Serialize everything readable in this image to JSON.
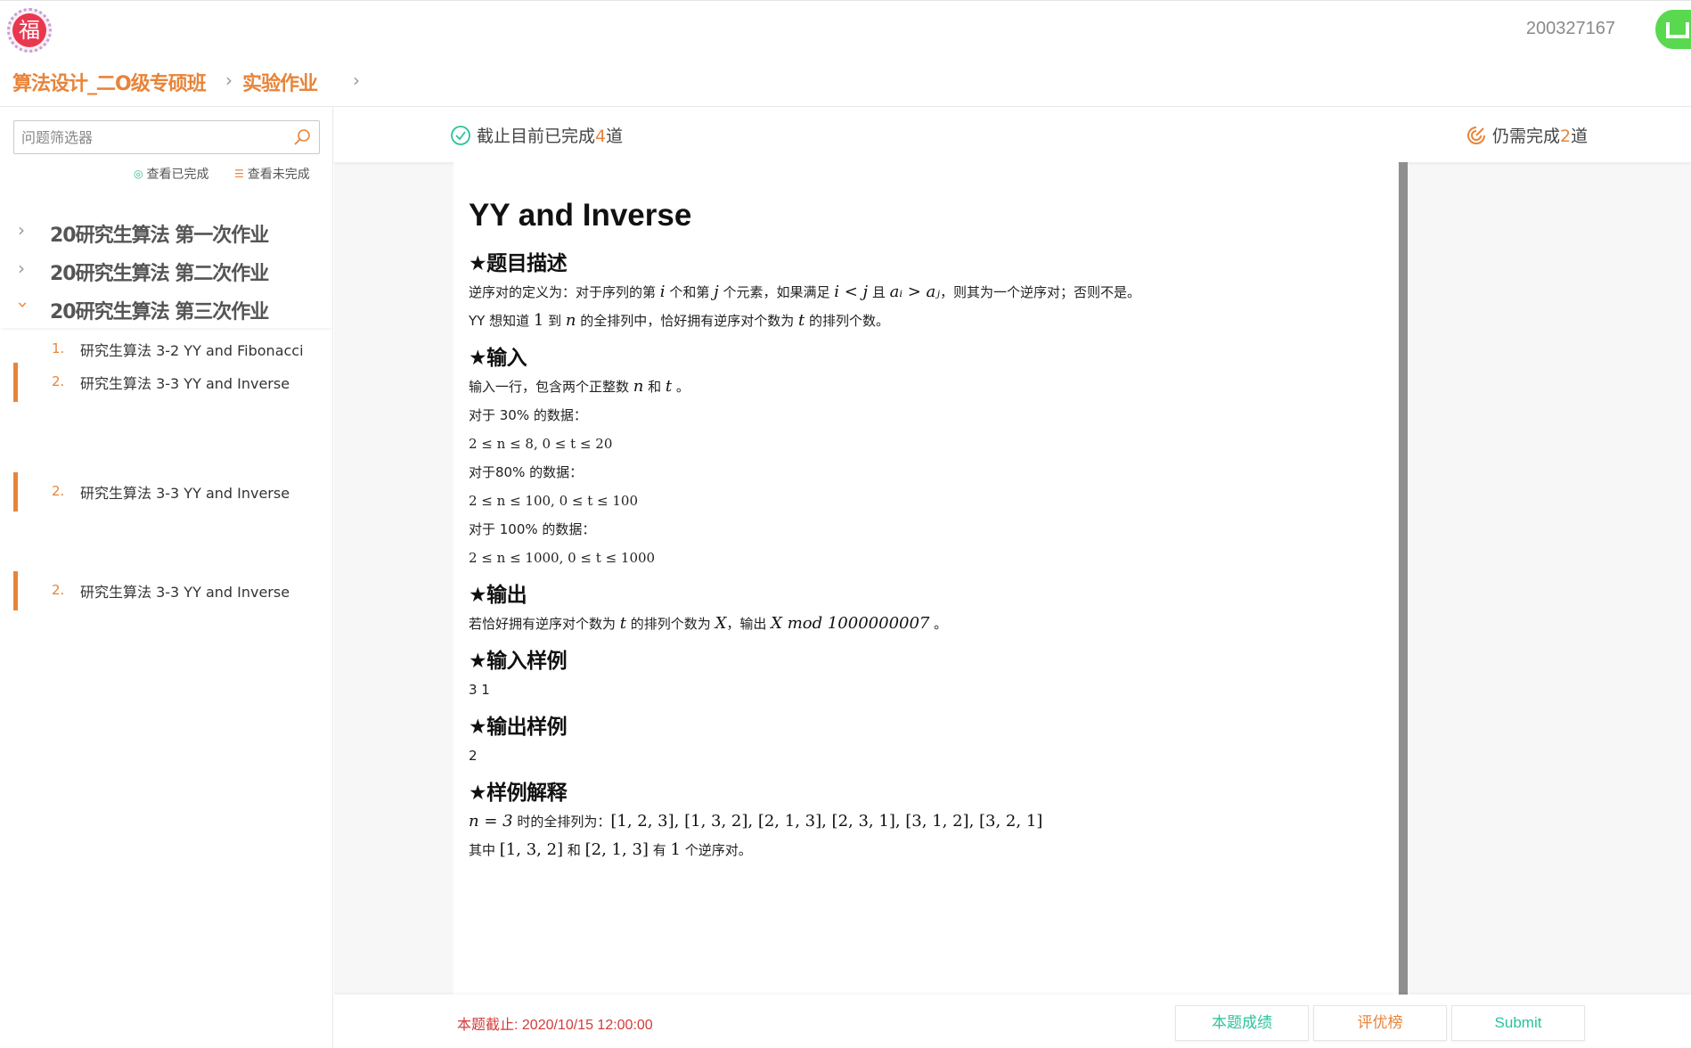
{
  "header": {
    "logo_char": "福",
    "user_id": "200327167"
  },
  "breadcrumb": {
    "course": "算法设计_二O级专硕班",
    "section": "实验作业"
  },
  "sidebar": {
    "filter_placeholder": "问题筛选器",
    "view_done": "查看已完成",
    "view_todo": "查看未完成",
    "sections": [
      {
        "title": "20研究生算法 第一次作业",
        "expanded": false
      },
      {
        "title": "20研究生算法 第二次作业",
        "expanded": false
      },
      {
        "title": "20研究生算法 第三次作业",
        "expanded": true
      }
    ],
    "problems": [
      {
        "num": "1.",
        "name": "研究生算法 3-2 YY and Fibonacci",
        "active": false
      },
      {
        "num": "2.",
        "name": "研究生算法 3-3 YY and Inverse",
        "active": true
      },
      {
        "num": "2.",
        "name": "研究生算法 3-3 YY and Inverse",
        "active": true
      },
      {
        "num": "2.",
        "name": "研究生算法 3-3 YY and Inverse",
        "active": true
      }
    ]
  },
  "status": {
    "done_prefix": "截止目前已完成",
    "done_count": "4",
    "done_suffix": "道",
    "remain_prefix": "仍需完成",
    "remain_count": "2",
    "remain_suffix": "道"
  },
  "problem": {
    "title": "YY and Inverse",
    "desc_heading": "★题目描述",
    "desc_line1_a": "逆序对的定义为：对于序列的第 ",
    "desc_line1_i": "i",
    "desc_line1_b": " 个和第 ",
    "desc_line1_j": "j",
    "desc_line1_c": " 个元素，如果满足 ",
    "desc_line1_cond": "i < j",
    "desc_line1_d": " 且 ",
    "desc_line1_cond2": "aᵢ > aⱼ",
    "desc_line1_e": "，则其为一个逆序对；否则不是。",
    "desc_line2_a": "YY 想知道 ",
    "desc_line2_one": "1",
    "desc_line2_b": " 到 ",
    "desc_line2_n": "n",
    "desc_line2_c": " 的全排列中，恰好拥有逆序对个数为 ",
    "desc_line2_t": "t",
    "desc_line2_d": " 的排列个数。",
    "input_heading": "★输入",
    "input_line_a": "输入一行，包含两个正整数 ",
    "input_n": "n",
    "input_and": " 和 ",
    "input_t": "t",
    "input_end": " 。",
    "case1_label": "对于 30% 的数据：",
    "case1_math": "2 ≤ n ≤ 8, 0 ≤ t ≤ 20",
    "case2_label": "对于80% 的数据：",
    "case2_math": "2 ≤ n ≤ 100, 0 ≤ t ≤ 100",
    "case3_label": "对于 100% 的数据：",
    "case3_math": "2 ≤ n ≤ 1000, 0 ≤ t ≤ 1000",
    "output_heading": "★输出",
    "output_a": "若恰好拥有逆序对个数为 ",
    "output_t": "t",
    "output_b": " 的排列个数为 ",
    "output_X": "X",
    "output_c": "，输出 ",
    "output_expr": "X mod 1000000007",
    "output_d": " 。",
    "sample_in_heading": "★输入样例",
    "sample_in": "3 1",
    "sample_out_heading": "★输出样例",
    "sample_out": "2",
    "explain_heading": "★样例解释",
    "explain_line1_n": "n = 3",
    "explain_line1_text": " 时的全排列为：",
    "explain_line1_perms": "[1, 2, 3], [1, 3, 2], [2, 1, 3], [2, 3, 1], [3, 1, 2], [3, 2, 1]",
    "explain_line2_a": "其中 ",
    "explain_line2_p1": "[1, 3, 2]",
    "explain_line2_b": " 和 ",
    "explain_line2_p2": "[2, 1, 3]",
    "explain_line2_c": " 有 ",
    "explain_line2_one": "1",
    "explain_line2_d": " 个逆序对。"
  },
  "footer": {
    "deadline": "本题截止: 2020/10/15 12:00:00",
    "score_button": "本题成绩",
    "rank_button": "评优榜",
    "submit_button": "Submit"
  },
  "colors": {
    "accent_orange": "#e8843a",
    "accent_green": "#2cc29b",
    "deadline_red": "#d43b3b"
  }
}
